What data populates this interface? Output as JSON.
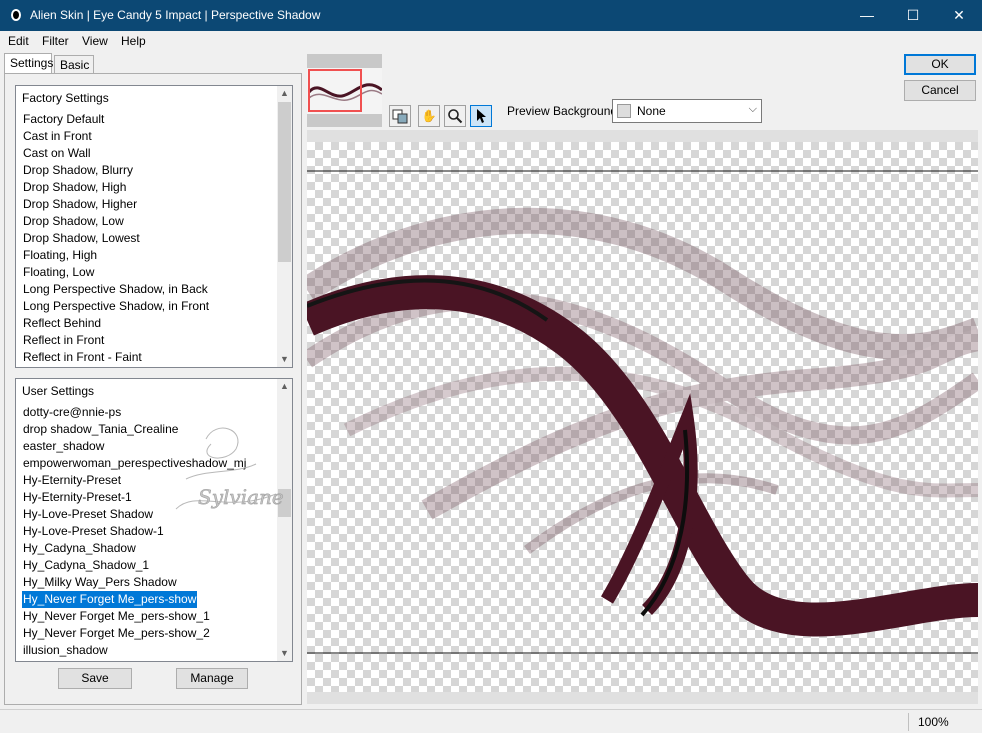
{
  "window": {
    "title": "Alien Skin | Eye Candy 5 Impact | Perspective Shadow",
    "minimize": "—",
    "maximize": "☐",
    "close": "✕"
  },
  "menu": {
    "edit": "Edit",
    "filter": "Filter",
    "view": "View",
    "help": "Help"
  },
  "tabs": {
    "settings": "Settings",
    "basic": "Basic"
  },
  "factory": {
    "header": "Factory Settings",
    "items": [
      "Factory Default",
      "Cast in Front",
      "Cast on Wall",
      "Drop Shadow, Blurry",
      "Drop Shadow, High",
      "Drop Shadow, Higher",
      "Drop Shadow, Low",
      "Drop Shadow, Lowest",
      "Floating, High",
      "Floating, Low",
      "Long Perspective Shadow, in Back",
      "Long Perspective Shadow, in Front",
      "Reflect Behind",
      "Reflect in Front",
      "Reflect in Front - Faint"
    ]
  },
  "user": {
    "header": "User Settings",
    "items": [
      "dotty-cre@nnie-ps",
      "drop shadow_Tania_Crealine",
      "easter_shadow",
      "empowerwoman_perespectiveshadow_mj",
      "Hy-Eternity-Preset",
      "Hy-Eternity-Preset-1",
      "Hy-Love-Preset Shadow",
      "Hy-Love-Preset Shadow-1",
      "Hy_Cadyna_Shadow",
      "Hy_Cadyna_Shadow_1",
      "Hy_Milky Way_Pers Shadow",
      "Hy_Never Forget Me_pers-show",
      "Hy_Never Forget Me_pers-show_1",
      "Hy_Never Forget Me_pers-show_2",
      "illusion_shadow"
    ],
    "selected": "Hy_Never Forget Me_pers-show"
  },
  "buttons": {
    "save": "Save",
    "manage": "Manage",
    "ok": "OK",
    "cancel": "Cancel"
  },
  "toolbar": {
    "icons": [
      "preview-toggle-icon",
      "hand-icon",
      "zoom-icon",
      "arrow-icon"
    ]
  },
  "preview_bg": {
    "label": "Preview Background:",
    "value": "None"
  },
  "watermark": "Sylviane",
  "status": {
    "zoom": "100%"
  },
  "colors": {
    "titlebar": "#0c4874",
    "ribbon": "#4a1424",
    "selection": "#0078d7"
  }
}
